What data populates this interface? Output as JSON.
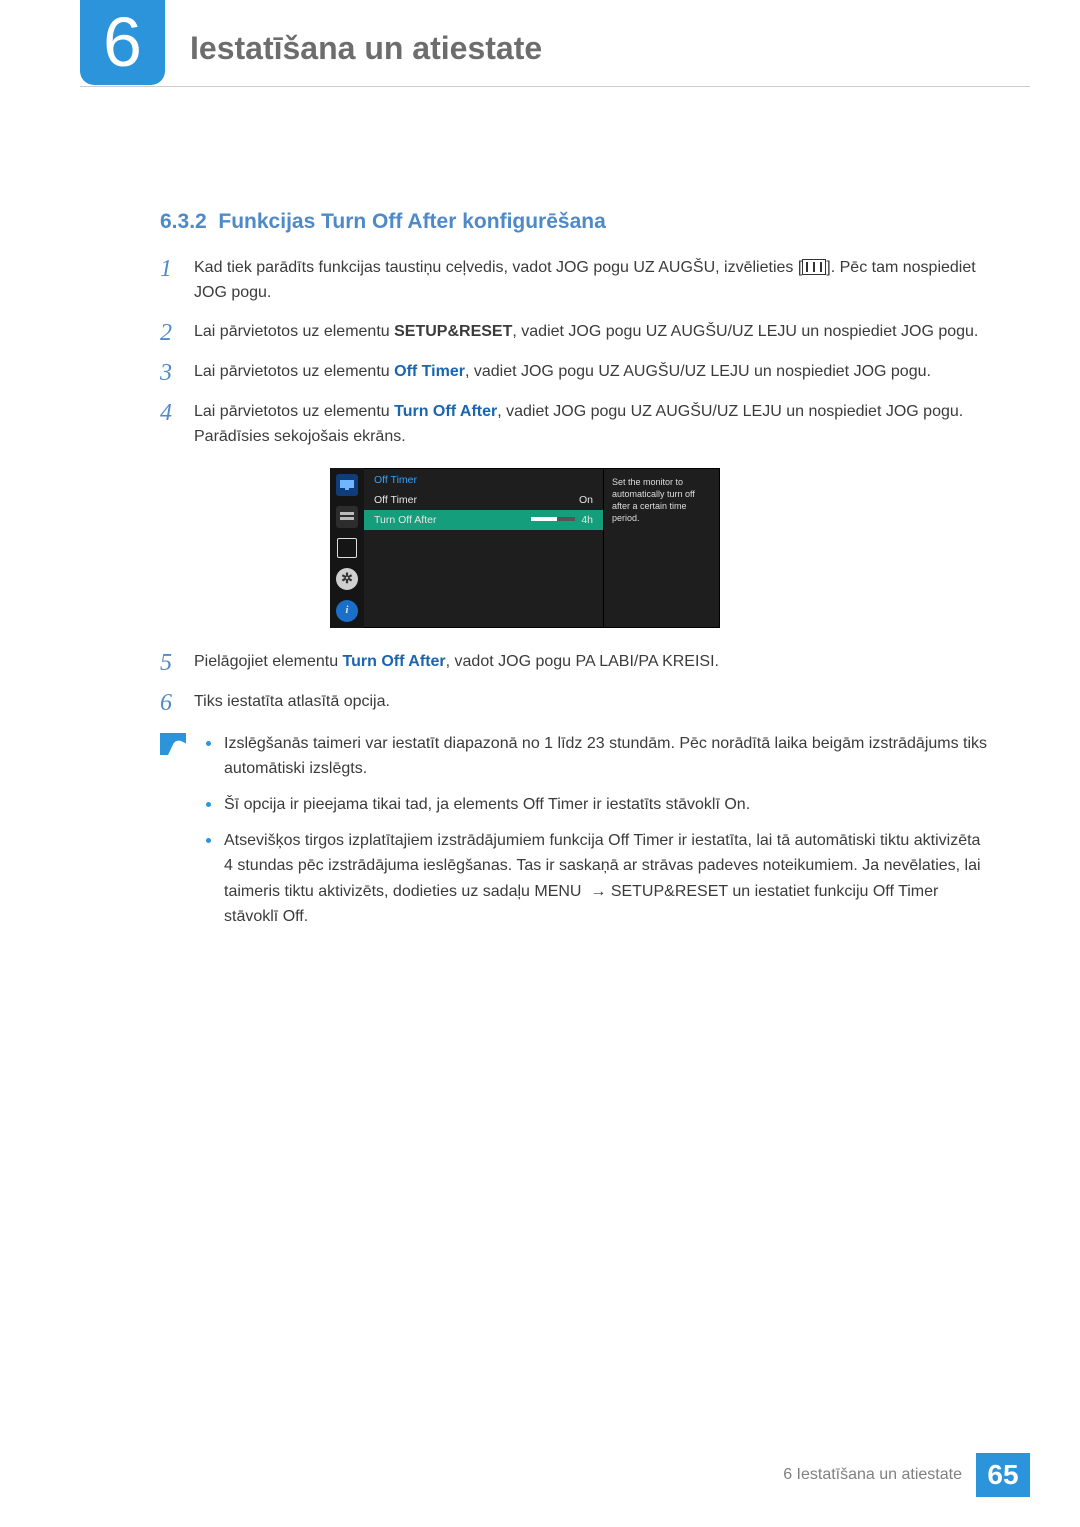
{
  "chapter": {
    "number": "6",
    "title": "Iestatīšana un atiestate"
  },
  "section": {
    "number": "6.3.2",
    "title": "Funkcijas Turn Off After konfigurēšana"
  },
  "steps": {
    "s1": {
      "num": "1",
      "a": "Kad tiek parādīts funkcijas taustiņu ceļvedis, vadot JOG pogu UZ AUGŠU, izvēlieties [",
      "b": "]. Pēc tam nospiediet JOG pogu."
    },
    "s2": {
      "num": "2",
      "a": "Lai pārvietotos uz elementu ",
      "bold": "SETUP&RESET",
      "b": ", vadiet JOG pogu UZ AUGŠU/UZ LEJU un nospiediet JOG pogu."
    },
    "s3": {
      "num": "3",
      "a": "Lai pārvietotos uz elementu ",
      "bold": "Off Timer",
      "b": ", vadiet JOG pogu UZ AUGŠU/UZ LEJU un nospiediet JOG pogu."
    },
    "s4": {
      "num": "4",
      "a": "Lai pārvietotos uz elementu ",
      "bold": "Turn Off After",
      "b": ", vadiet JOG pogu UZ AUGŠU/UZ LEJU un nospiediet JOG pogu. Parādīsies sekojošais ekrāns."
    },
    "s5": {
      "num": "5",
      "a": "Pielāgojiet elementu ",
      "bold": "Turn Off After",
      "b": ", vadot JOG pogu PA LABI/PA KREISI."
    },
    "s6": {
      "num": "6",
      "a": "Tiks iestatīta atlasītā opcija."
    }
  },
  "osd": {
    "title": "Off Timer",
    "row1": {
      "label": "Off Timer",
      "value": "On"
    },
    "row2": {
      "label": "Turn Off After",
      "value": "4h"
    },
    "help": "Set the monitor to automatically turn off after a certain time period."
  },
  "notes": {
    "n1": "Izslēgšanās taimeri var iestatīt diapazonā no 1 līdz 23 stundām. Pēc norādītā laika beigām izstrādājums tiks automātiski izslēgts.",
    "n2": {
      "a": "Šī opcija ir pieejama tikai tad, ja elements ",
      "b1": "Off Timer",
      "b": " ir iestatīts stāvoklī ",
      "b2": "On",
      "c": "."
    },
    "n3": {
      "a": "Atsevišķos tirgos izplatītajiem izstrādājumiem funkcija ",
      "b1": "Off Timer",
      "b": " ir iestatīta, lai tā automātiski tiktu aktivizēta 4 stundas pēc izstrādājuma ieslēgšanas. Tas ir saskaņā ar strāvas padeves noteikumiem. Ja nevēlaties, lai taimeris tiktu aktivizēts, dodieties uz sadaļu ",
      "b2": "MENU",
      "arrow": "→",
      "b3": "SETUP&RESET",
      "c": " un iestatiet funkciju ",
      "b4": "Off Timer",
      "d": " stāvoklī ",
      "b5": "Off",
      "e": "."
    }
  },
  "footer": {
    "label": "6 Iestatīšana un atiestate",
    "page": "65"
  }
}
